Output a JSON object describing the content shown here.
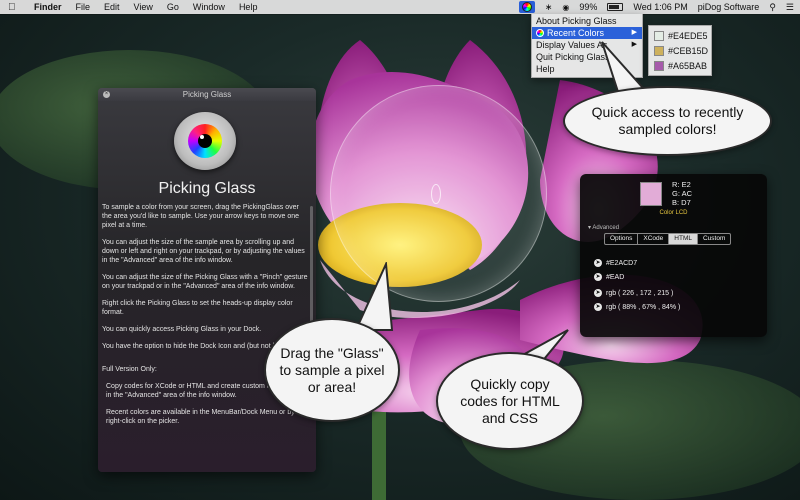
{
  "menubar": {
    "app": "Finder",
    "items": [
      "File",
      "Edit",
      "View",
      "Go",
      "Window",
      "Help"
    ],
    "battery": "99%",
    "clock": "Wed 1:06 PM",
    "user": "piDog Software"
  },
  "dropdown": {
    "items": [
      "About Picking Glass",
      "Recent Colors",
      "Display Values As",
      "Quit Picking Glass",
      "Help"
    ]
  },
  "recent_colors": [
    {
      "label": "#E4EDE5",
      "color": "#E4EDE5"
    },
    {
      "label": "#CEB15D",
      "color": "#CEB15D"
    },
    {
      "label": "#A65BAB",
      "color": "#A65BAB"
    }
  ],
  "info_window": {
    "title": "Picking Glass",
    "app_name": "Picking Glass",
    "paragraphs": [
      "To sample a color from your screen, drag the PickingGlass over the area you'd like to sample. Use your arrow keys to move one pixel at a time.",
      "You can adjust the size of the sample area by scrolling up and down or left and right on your trackpad, or by adjusting the values in the \"Advanced\" area of the info window.",
      "You can adjust the size of the Picking Glass with a \"Pinch\" gesture on your trackpad or in the \"Advanced\" area of the info window.",
      "Right click the Picking Glass to set the heads-up display color format.",
      "You can quickly access Picking Glass in your Dock.",
      "You have the option to hide the Dock Icon and (but not both).",
      "Full Version Only:",
      "Copy codes for XCode or HTML and create custom color formats in the \"Advanced\" area of the info window.",
      "Recent colors are available in the MenuBar/Dock Menu or by right-click on the picker."
    ]
  },
  "callouts": {
    "recent": "Quick access to recently sampled colors!",
    "drag": "Drag the \"Glass\" to sample a pixel or area!",
    "copy": "Quickly copy codes for HTML and CSS"
  },
  "hud": {
    "swatch_color": "#E2ACD7",
    "r": "R: E2",
    "g": "G: AC",
    "b": "B: D7",
    "device": "Color LCD",
    "advanced": "Advanced",
    "tabs": [
      "Options",
      "XCode",
      "HTML",
      "Custom"
    ],
    "active_tab": "HTML",
    "codes": [
      "#E2ACD7",
      "#EAD",
      "rgb ( 226 , 172 , 215 )",
      "rgb ( 88% , 67% , 84% )"
    ]
  }
}
